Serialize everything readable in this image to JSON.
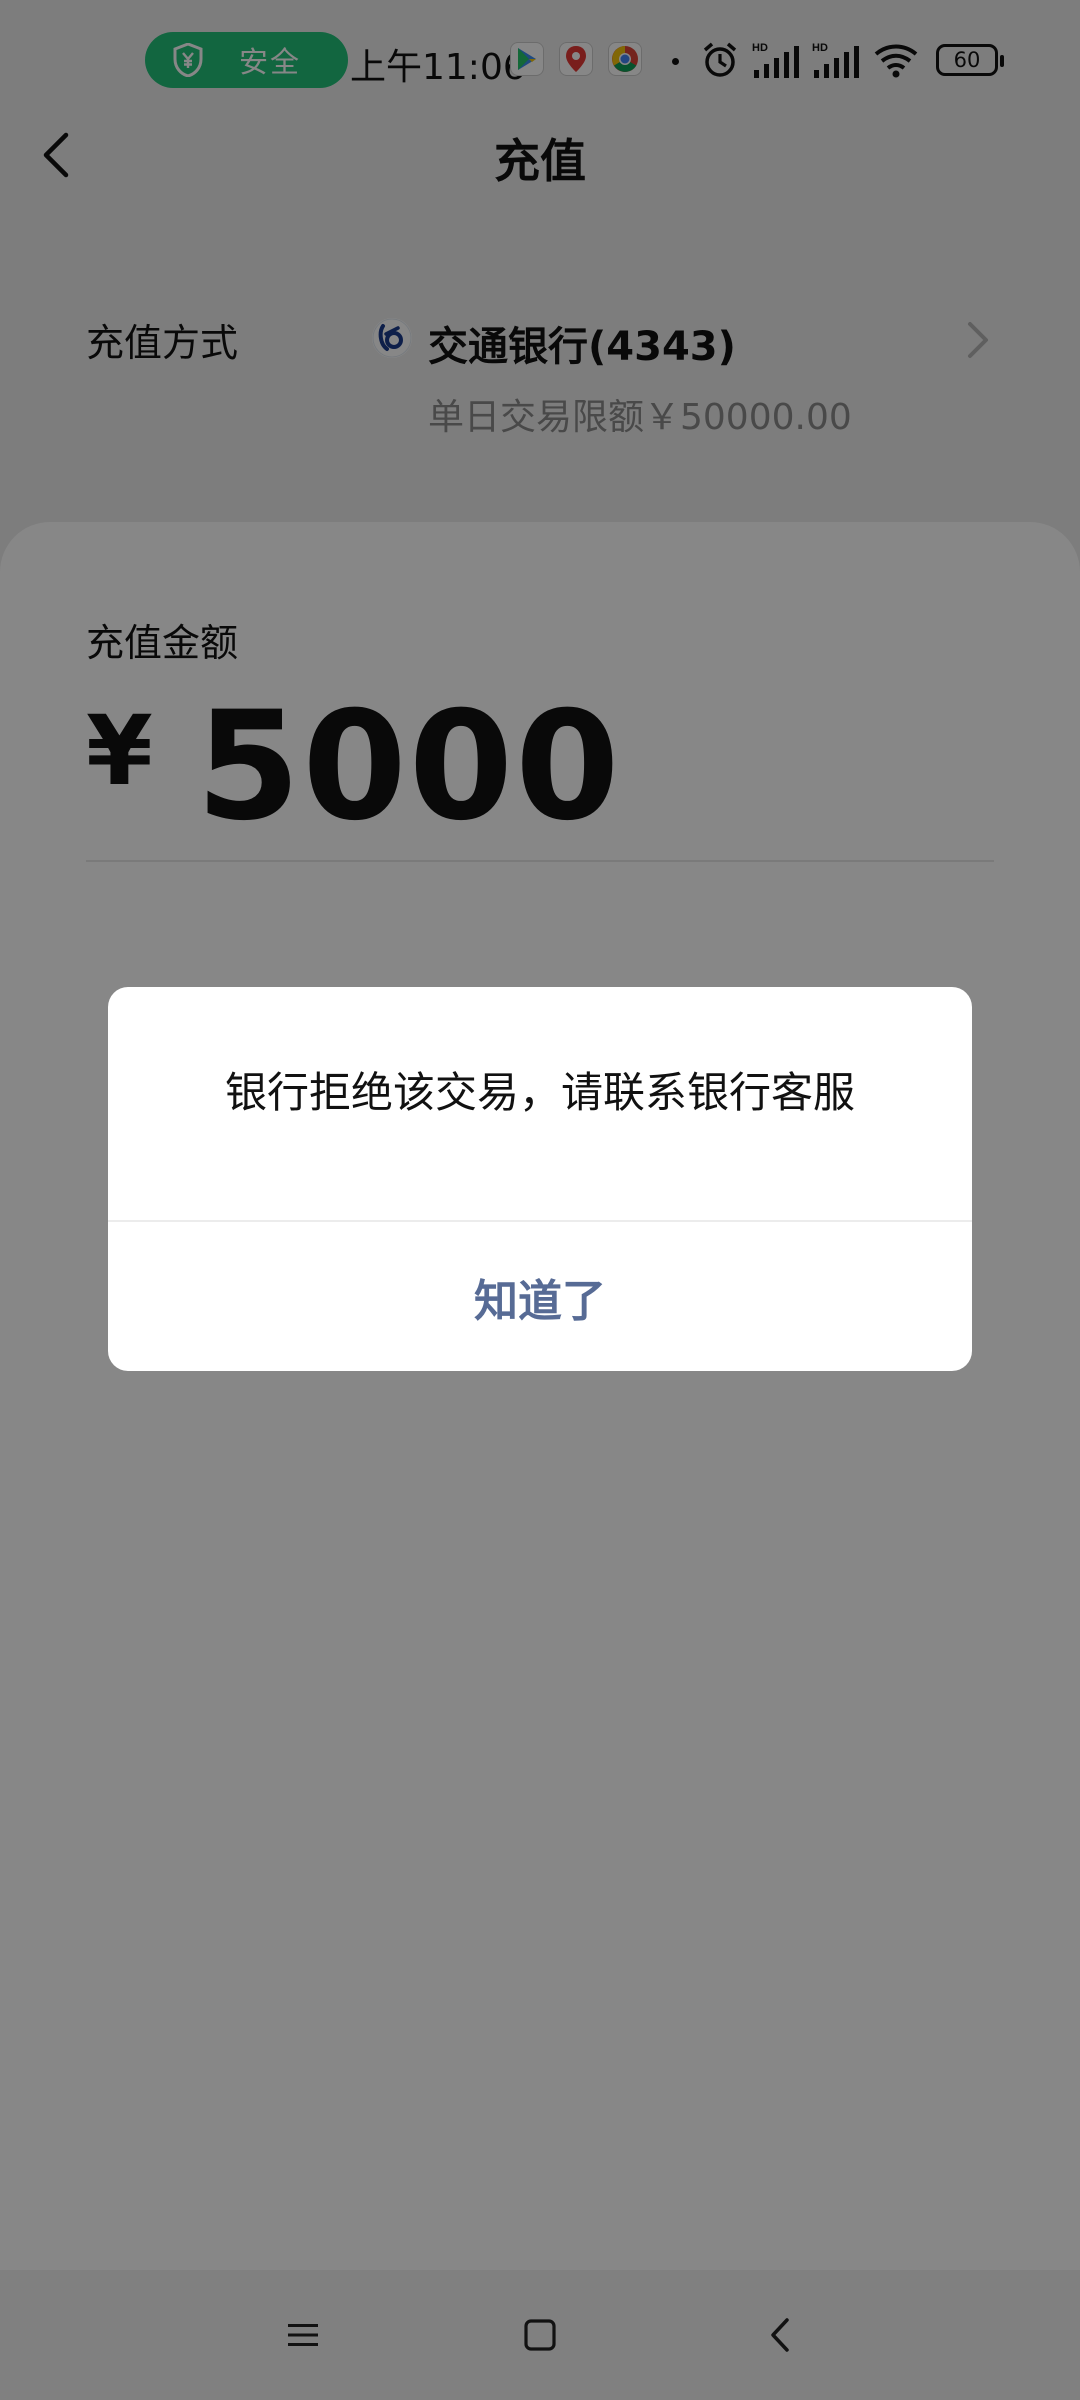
{
  "status_bar": {
    "secure_label": "安全",
    "time": "上午11:06",
    "battery": "60",
    "signal_badge": "HD",
    "icons": [
      "shield-yuan-icon",
      "play-store-icon",
      "map-pin-icon",
      "chrome-icon",
      "alarm-icon",
      "signal-icon",
      "signal-icon",
      "wifi-icon",
      "battery-icon"
    ]
  },
  "header": {
    "title": "充值",
    "back_icon": "chevron-left-icon"
  },
  "payment_method": {
    "label": "充值方式",
    "bank": "交通银行(4343)",
    "limit": "单日交易限额￥50000.00",
    "chevron_icon": "chevron-right-icon"
  },
  "amount": {
    "label": "充值金额",
    "currency": "¥",
    "value": "5000"
  },
  "dialog": {
    "message": "银行拒绝该交易，请联系银行客服",
    "button": "知道了"
  },
  "nav_bar": {
    "items": [
      "menu-icon",
      "home-icon",
      "back-icon"
    ]
  },
  "colors": {
    "secure_green": "#22c07a",
    "dialog_button": "#576b95",
    "overlay": "rgba(0,0,0,0.47)"
  }
}
